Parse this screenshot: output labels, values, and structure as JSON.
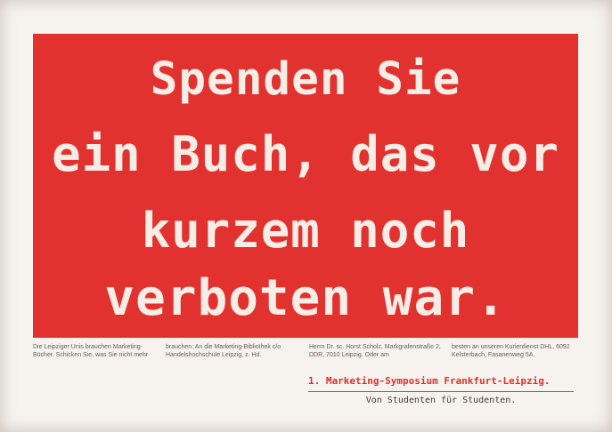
{
  "headline": {
    "line1": "Spenden Sie",
    "line2": "ein Buch, das vor",
    "line3": "kurzem noch",
    "line4": "verboten war."
  },
  "body_text": {
    "col1": "Die Leipziger Unis brauchen Marketing-Bücher. Schicken Sie, was Sie nicht mehr",
    "col2": "brauchen: An die Marketing-Bibliothek c/o Handelshochschule Leipzig, z. Hd.",
    "col3": "Herrn Dr. sc. Horst Scholz, Markgrafenstraße 2, DDR, 7010 Leipzig. Oder am",
    "col4": "besten an unseren Kurierdienst DHL, 6092 Kelsterbach, Fasanenweg 5A."
  },
  "footer": {
    "title": "1. Marketing-Symposium Frankfurt-Leipzig.",
    "subtitle": "Von Studenten für Studenten."
  },
  "colors": {
    "panel": "#e2322f",
    "headline_text": "#f6eee6",
    "footer_title": "#d8322d"
  }
}
